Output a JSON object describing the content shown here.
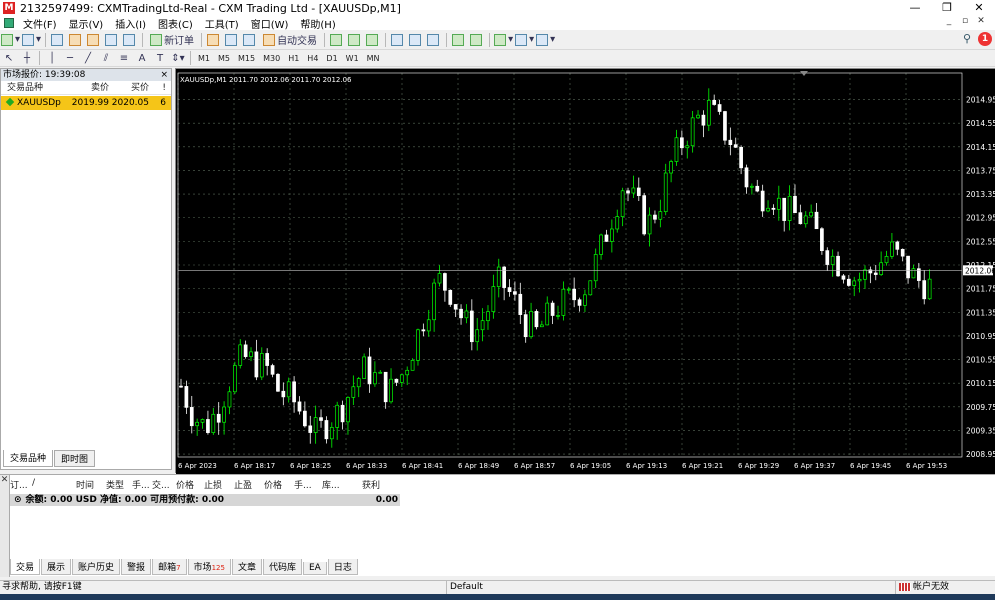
{
  "window": {
    "title": "2132597499: CXMTradingLtd-Real - CXM Trading Ltd - [XAUUSDp,M1]",
    "minimize": "—",
    "restore": "❐",
    "close": "✕"
  },
  "menu": {
    "items": [
      "文件(F)",
      "显示(V)",
      "插入(I)",
      "图表(C)",
      "工具(T)",
      "窗口(W)",
      "帮助(H)"
    ]
  },
  "toolbar": {
    "new_order": "新订单",
    "auto_trading": "自动交易",
    "notifications": "1",
    "timeframes": [
      "M1",
      "M5",
      "M15",
      "M30",
      "H1",
      "H4",
      "D1",
      "W1",
      "MN"
    ]
  },
  "market_watch": {
    "title": "市场报价: 19:39:08",
    "close": "×",
    "columns": [
      "交易品种",
      "卖价",
      "买价",
      "!"
    ],
    "rows": [
      {
        "symbol": "XAUUSDp",
        "bid": "2019.99",
        "ask": "2020.05",
        "spread": "6"
      }
    ],
    "tabs": [
      "交易品种",
      "即时图"
    ]
  },
  "chart_data": {
    "type": "candlestick",
    "symbol_label": "XAUUSDp,M1  2011.70 2012.06 2011.70 2012.06",
    "ylim": [
      2008.9,
      2015.4
    ],
    "y_ticks": [
      "2014.95",
      "2014.55",
      "2014.15",
      "2013.75",
      "2013.35",
      "2012.95",
      "2012.55",
      "2012.15",
      "2011.75",
      "2011.35",
      "2010.95",
      "2010.55",
      "2010.15",
      "2009.75",
      "2009.35",
      "2008.95"
    ],
    "current_price": "2012.06",
    "x_ticks": [
      "6 Apr 2023",
      "6 Apr 18:17",
      "6 Apr 18:25",
      "6 Apr 18:33",
      "6 Apr 18:41",
      "6 Apr 18:49",
      "6 Apr 18:57",
      "6 Apr 19:05",
      "6 Apr 19:13",
      "6 Apr 19:21",
      "6 Apr 19:29",
      "6 Apr 19:37",
      "6 Apr 19:45",
      "6 Apr 19:53"
    ],
    "close_path": [
      2010.1,
      2009.6,
      2009.4,
      2009.7,
      2010.2,
      2010.6,
      2010.5,
      2010.4,
      2010.0,
      2009.9,
      2009.6,
      2009.3,
      2009.5,
      2009.7,
      2010.1,
      2010.4,
      2010.2,
      2010.0,
      2010.3,
      2010.8,
      2011.4,
      2011.9,
      2011.7,
      2011.2,
      2011.0,
      2011.4,
      2011.9,
      2011.6,
      2011.2,
      2011.0,
      2011.3,
      2011.5,
      2011.6,
      2011.8,
      2012.3,
      2012.9,
      2013.5,
      2013.2,
      2012.8,
      2013.2,
      2013.9,
      2014.3,
      2014.6,
      2014.8,
      2014.5,
      2014.2,
      2013.6,
      2013.3,
      2013.4,
      2013.1,
      2013.0,
      2012.9,
      2012.6,
      2012.3,
      2012.1,
      2011.9,
      2012.0,
      2012.2,
      2012.4,
      2012.1,
      2011.9,
      2011.8
    ]
  },
  "terminal": {
    "columns": [
      "订...",
      "/",
      "时间",
      "类型",
      "手...",
      "交...",
      "价格",
      "止损",
      "止盈",
      "价格",
      "手...",
      "库...",
      "获利"
    ],
    "balance_line": "余额: 0.00 USD  净值: 0.00  可用预付款: 0.00",
    "profit": "0.00",
    "side_label": "终端",
    "tabs": [
      {
        "label": "交易"
      },
      {
        "label": "展示"
      },
      {
        "label": "账户历史"
      },
      {
        "label": "警报"
      },
      {
        "label": "邮箱",
        "badge": "7"
      },
      {
        "label": "市场",
        "badge": "125"
      },
      {
        "label": "文章"
      },
      {
        "label": "代码库"
      },
      {
        "label": "EA"
      },
      {
        "label": "日志"
      }
    ]
  },
  "status": {
    "help": "寻求帮助, 请按F1键",
    "profile": "Default",
    "connection": "帐户无效"
  },
  "colors": {
    "bull": "#ffffff",
    "bear": "#00ff00",
    "grid": "#5a6b5a",
    "chart_bg": "#000000",
    "quote_row": "#f5c518"
  }
}
